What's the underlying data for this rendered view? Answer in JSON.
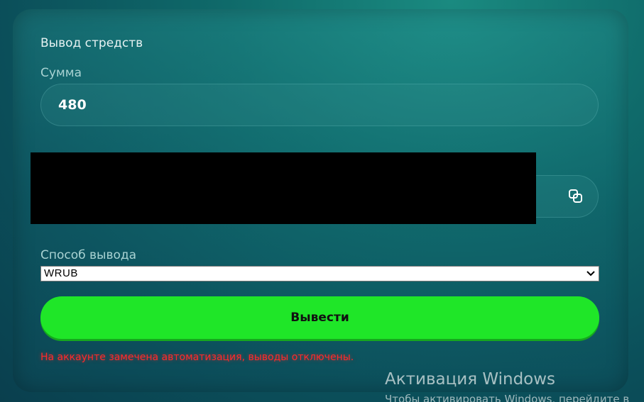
{
  "form": {
    "title": "Вывод стредств",
    "amount_label": "Сумма",
    "amount_value": "480",
    "method_label": "Способ вывода",
    "method_selected": "WRUB",
    "submit_label": "Вывести",
    "error_message": "На аккаунте замечена автоматизация, выводы отключены."
  },
  "icons": {
    "copy": "copy-icon",
    "select": "chevron-down-icon"
  },
  "colors": {
    "submit_bg": "#1fe628",
    "error": "#ff2a2a"
  },
  "watermark": {
    "title": "Активация Windows",
    "subtitle": "Чтобы активировать Windows, перейдите в"
  }
}
